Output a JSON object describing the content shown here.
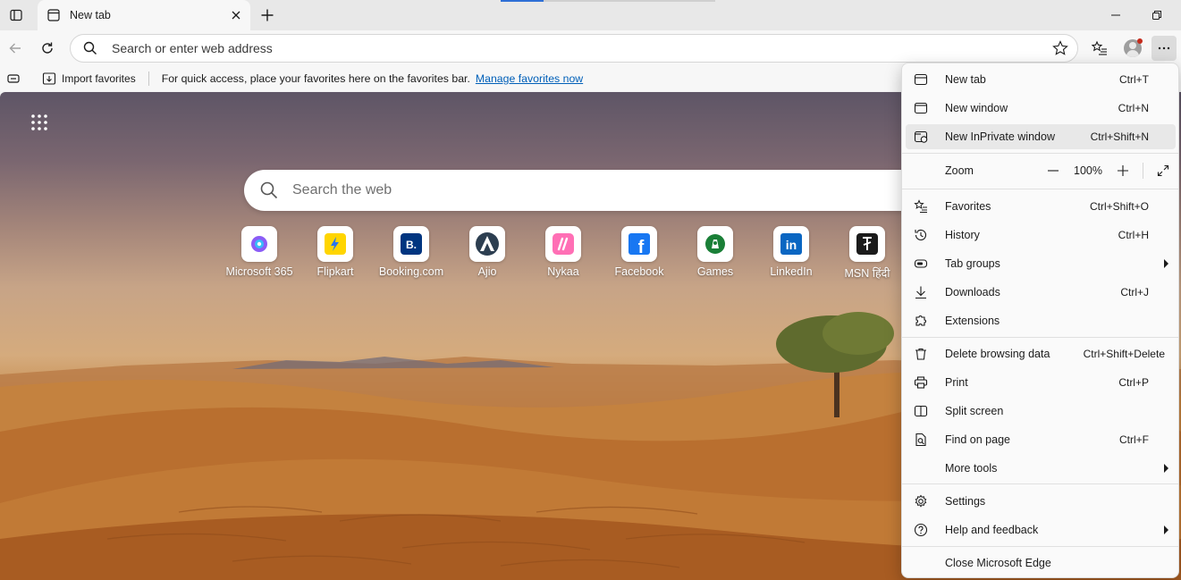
{
  "tab": {
    "title": "New tab"
  },
  "addressbar": {
    "placeholder": "Search or enter web address"
  },
  "favbar": {
    "import_label": "Import favorites",
    "message": "For quick access, place your favorites here on the favorites bar.",
    "link": "Manage favorites now"
  },
  "search": {
    "placeholder": "Search the web"
  },
  "tiles": [
    {
      "label": "Microsoft 365",
      "icon": "microsoft-365-icon"
    },
    {
      "label": "Flipkart",
      "icon": "flipkart-icon"
    },
    {
      "label": "Booking.com",
      "icon": "booking-icon",
      "glyph": "B."
    },
    {
      "label": "Ajio",
      "icon": "ajio-icon"
    },
    {
      "label": "Nykaa",
      "icon": "nykaa-icon"
    },
    {
      "label": "Facebook",
      "icon": "facebook-icon",
      "glyph": "f"
    },
    {
      "label": "Games",
      "icon": "games-icon"
    },
    {
      "label": "LinkedIn",
      "icon": "linkedin-icon",
      "glyph": "in"
    },
    {
      "label": "MSN हिंदी",
      "icon": "msn-hindi-icon"
    }
  ],
  "menu": {
    "new_tab": {
      "label": "New tab",
      "shortcut": "Ctrl+T"
    },
    "new_window": {
      "label": "New window",
      "shortcut": "Ctrl+N"
    },
    "new_inprivate": {
      "label": "New InPrivate window",
      "shortcut": "Ctrl+Shift+N"
    },
    "zoom": {
      "label": "Zoom",
      "value": "100%"
    },
    "favorites": {
      "label": "Favorites",
      "shortcut": "Ctrl+Shift+O"
    },
    "history": {
      "label": "History",
      "shortcut": "Ctrl+H"
    },
    "tab_groups": {
      "label": "Tab groups"
    },
    "downloads": {
      "label": "Downloads",
      "shortcut": "Ctrl+J"
    },
    "extensions": {
      "label": "Extensions"
    },
    "delete_browsing": {
      "label": "Delete browsing data",
      "shortcut": "Ctrl+Shift+Delete"
    },
    "print": {
      "label": "Print",
      "shortcut": "Ctrl+P"
    },
    "split_screen": {
      "label": "Split screen"
    },
    "find_on_page": {
      "label": "Find on page",
      "shortcut": "Ctrl+F"
    },
    "more_tools": {
      "label": "More tools"
    },
    "settings": {
      "label": "Settings"
    },
    "help": {
      "label": "Help and feedback"
    },
    "close_edge": {
      "label": "Close Microsoft Edge"
    }
  },
  "colors": {
    "accent": "#005fb8",
    "menu_bg": "#fafafa",
    "highlight": "#e8e8e8"
  }
}
